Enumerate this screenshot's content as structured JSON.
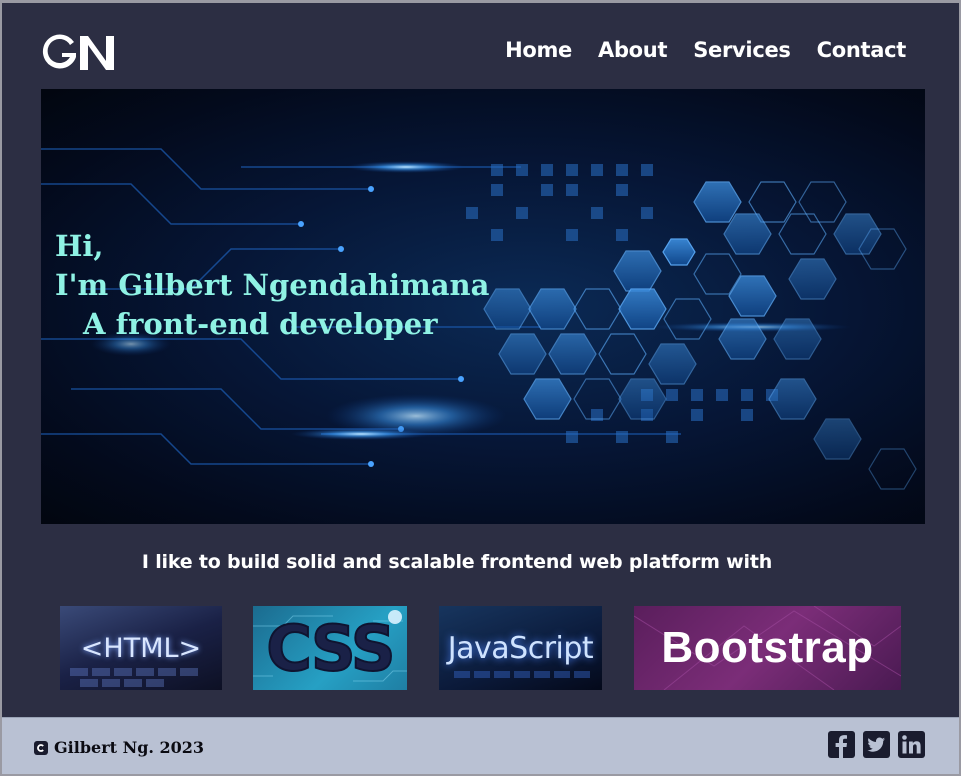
{
  "brand": {
    "logo_text": "GN"
  },
  "nav": {
    "items": [
      {
        "label": "Home"
      },
      {
        "label": "About"
      },
      {
        "label": "Services"
      },
      {
        "label": "Contact"
      }
    ]
  },
  "hero": {
    "line1": "Hi,",
    "line2": "I'm Gilbert Ngendahimana",
    "line3": "A front-end developer",
    "text_color": "#8ff2e4"
  },
  "skills": {
    "tagline": "I like to build solid and scalable frontend web platform with",
    "tiles": [
      {
        "label": "<HTML>",
        "icon": "html-logo"
      },
      {
        "label": "CSS",
        "icon": "css-logo"
      },
      {
        "label": "JavaScript",
        "icon": "javascript-logo"
      },
      {
        "label": "Bootstrap",
        "icon": "bootstrap-logo"
      }
    ]
  },
  "footer": {
    "copyright": "Gilbert Ng. 2023",
    "copyright_icon": "copyright-icon",
    "social": [
      {
        "icon": "facebook-icon"
      },
      {
        "icon": "twitter-icon"
      },
      {
        "icon": "linkedin-icon"
      }
    ],
    "background": "#b9c1d3"
  },
  "colors": {
    "page_background": "#2c2e43",
    "nav_text": "#ffffff",
    "accent": "#8ff2e4"
  }
}
